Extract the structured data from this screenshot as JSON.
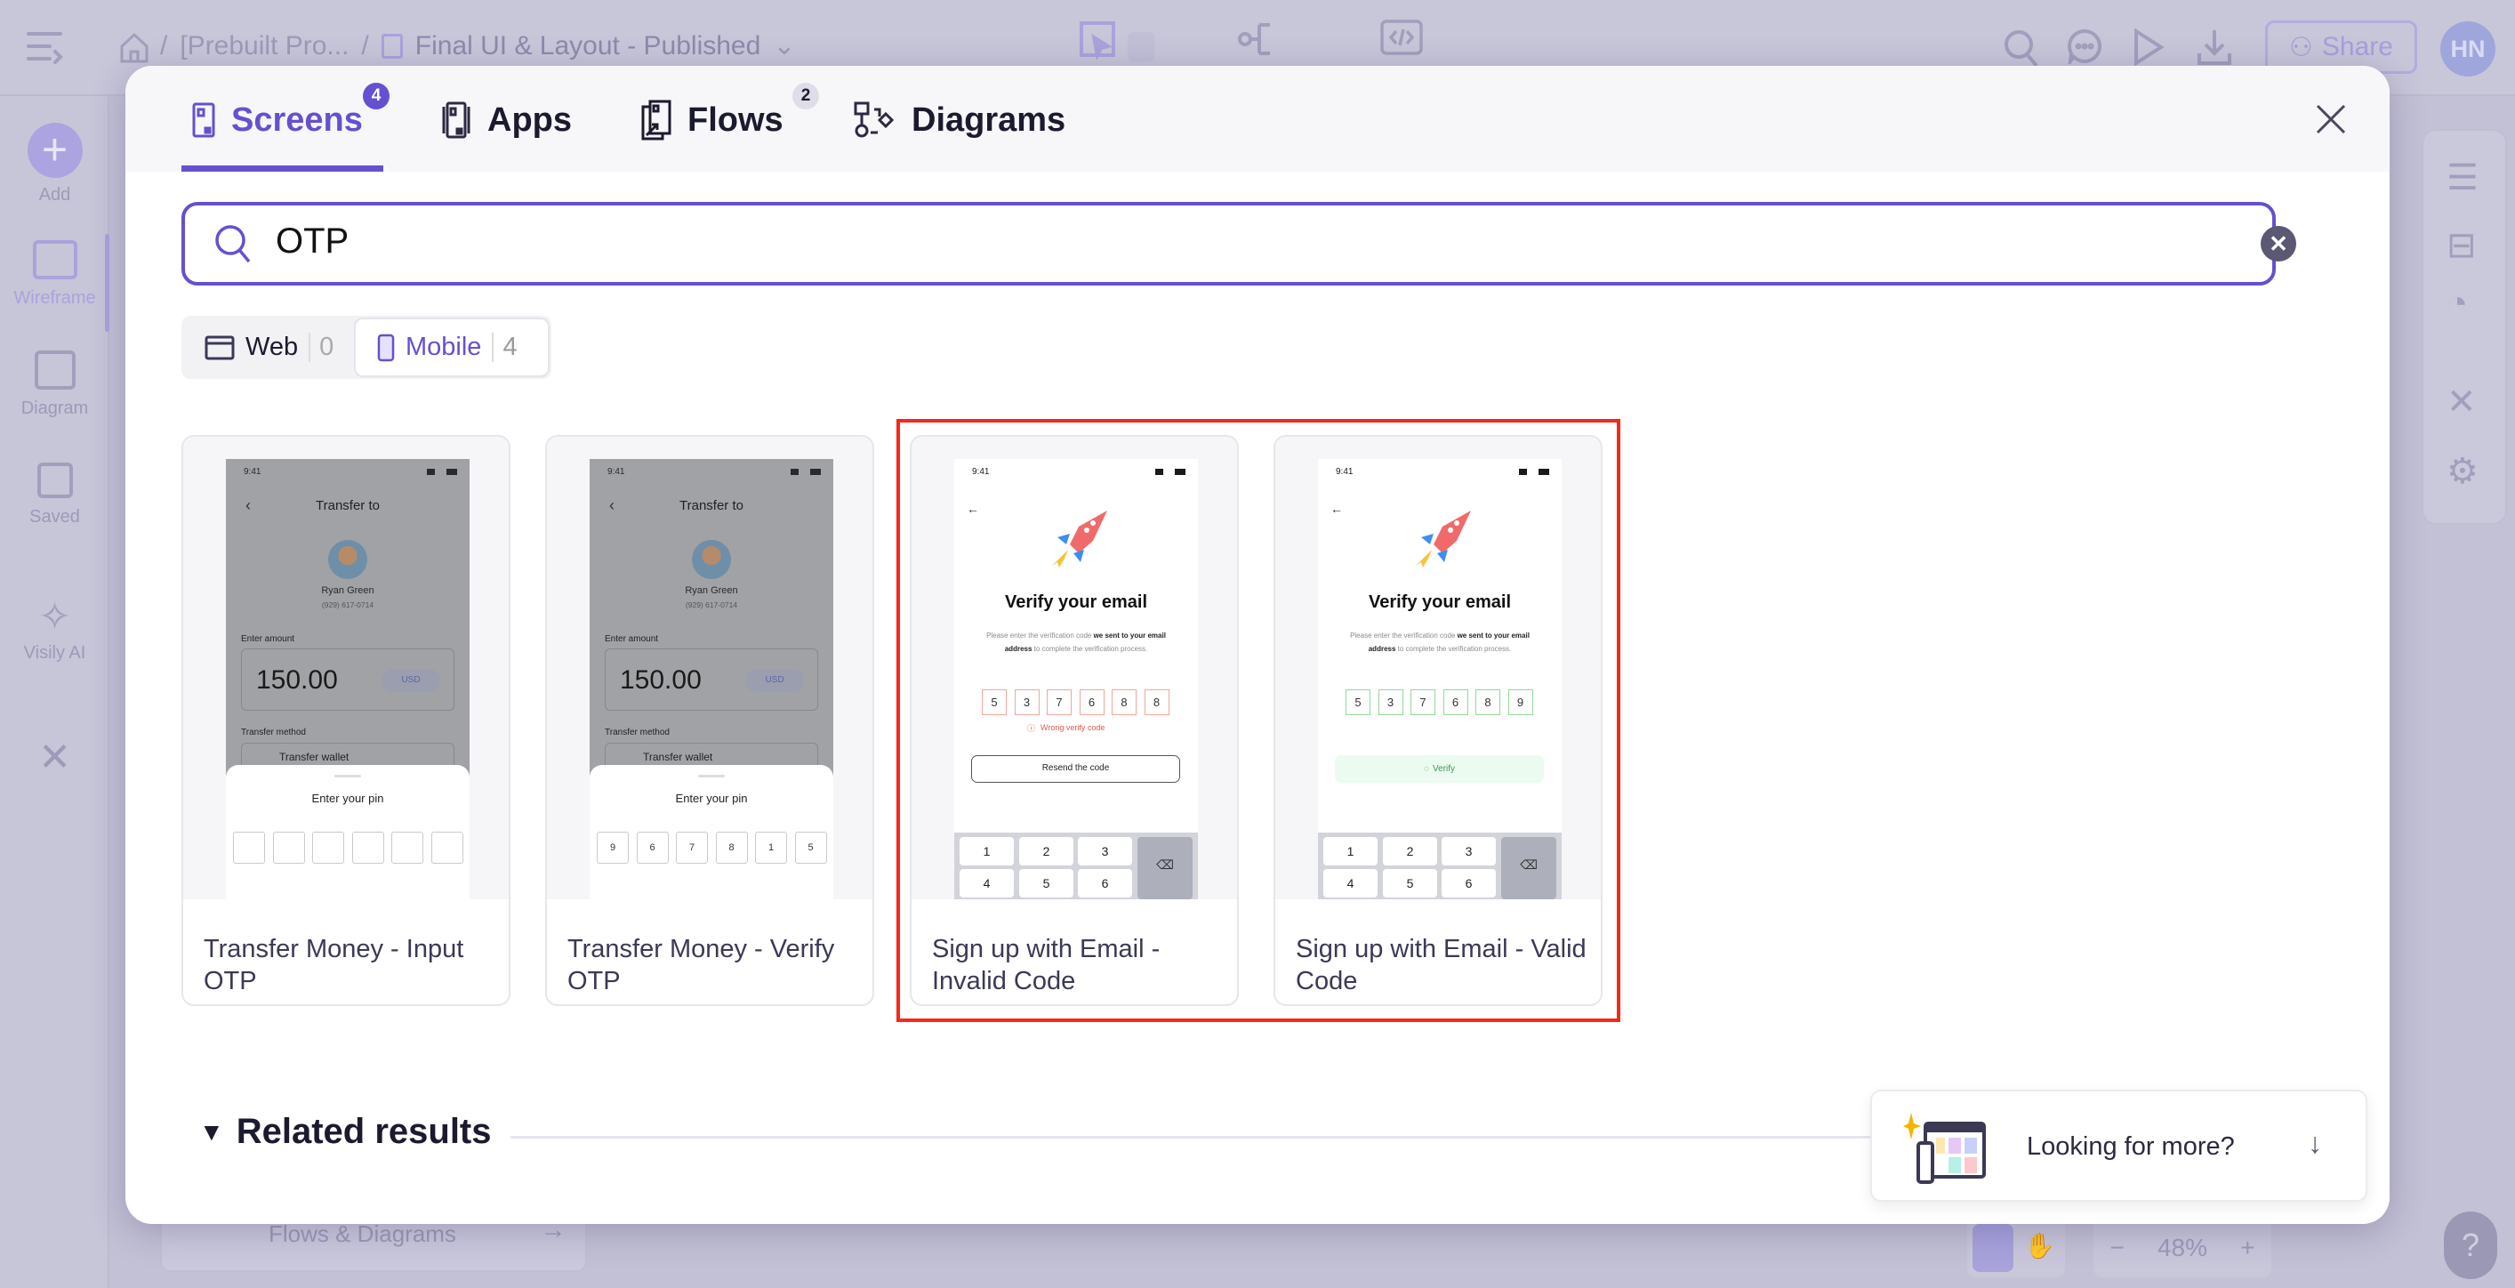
{
  "app": {
    "breadcrumb": [
      "[Prebuilt Pro...",
      "Final UI & Layout - Published"
    ],
    "share_label": "Share",
    "avatar_initials": "HN",
    "sidebar": [
      {
        "label": "Add",
        "icon": "plus-icon"
      },
      {
        "label": "Wireframe",
        "icon": "wireframe-icon"
      },
      {
        "label": "Diagram",
        "icon": "diagram-icon"
      },
      {
        "label": "Saved",
        "icon": "save-icon"
      },
      {
        "label": "Visily AI",
        "icon": "sparkle-icon"
      }
    ],
    "bottom_card_label": "Flows & Diagrams",
    "zoom_level": "48%"
  },
  "modal": {
    "tabs": [
      {
        "label": "Screens",
        "badge": "4",
        "active": true,
        "icon": "screen-icon"
      },
      {
        "label": "Apps",
        "badge": "",
        "icon": "apps-icon"
      },
      {
        "label": "Flows",
        "badge": "2",
        "icon": "flows-icon"
      },
      {
        "label": "Diagrams",
        "badge": "",
        "icon": "diagrams-icon"
      }
    ],
    "search": {
      "value": "OTP"
    },
    "filters": [
      {
        "label": "Web",
        "count": "0",
        "selected": false
      },
      {
        "label": "Mobile",
        "count": "4",
        "selected": true
      }
    ],
    "results": [
      {
        "title": "Transfer Money - Input OTP",
        "type": "transfer",
        "phone": {
          "time": "9:41",
          "header": "Transfer to",
          "name": "Ryan Green",
          "number": "(929) 617-0714",
          "amount_label": "Enter amount",
          "amount": "150.00",
          "currency": "USD",
          "method_label": "Transfer method",
          "method": "Transfer wallet",
          "sheet_title": "Enter your pin",
          "pin": [
            "",
            "",
            "",
            "",
            "",
            ""
          ]
        }
      },
      {
        "title": "Transfer Money - Verify OTP",
        "type": "transfer",
        "phone": {
          "time": "9:41",
          "header": "Transfer to",
          "name": "Ryan Green",
          "number": "(929) 617-0714",
          "amount_label": "Enter amount",
          "amount": "150.00",
          "currency": "USD",
          "method_label": "Transfer method",
          "method": "Transfer wallet",
          "sheet_title": "Enter your pin",
          "pin": [
            "9",
            "6",
            "7",
            "8",
            "1",
            "5"
          ]
        }
      },
      {
        "title": "Sign up with Email - Invalid Code",
        "type": "verify",
        "state": "invalid",
        "phone": {
          "time": "9:41",
          "heading": "Verify your email",
          "body": [
            "Please enter the verification code ",
            "we sent to your email address",
            " to complete the verification process."
          ],
          "code": [
            "5",
            "3",
            "7",
            "6",
            "8",
            "8"
          ],
          "error": "Wrong verify code",
          "button": "Resend the code",
          "keys": [
            "1",
            "2",
            "3",
            "4",
            "5",
            "6"
          ]
        }
      },
      {
        "title": "Sign up with Email - Valid Code",
        "type": "verify",
        "state": "valid",
        "phone": {
          "time": "9:41",
          "heading": "Verify your email",
          "body": [
            "Please enter the verification code ",
            "we sent to your email address",
            " to complete the verification process."
          ],
          "code": [
            "5",
            "3",
            "7",
            "6",
            "8",
            "9"
          ],
          "error": "",
          "button": "Verify",
          "keys": [
            "1",
            "2",
            "3",
            "4",
            "5",
            "6"
          ]
        }
      }
    ],
    "related_label": "Related results",
    "more_label": "Looking for more?"
  },
  "colors": {
    "accent": "#6550d0",
    "highlight": "#f5281c",
    "error": "#e8574a",
    "success": "#4cc46a"
  }
}
